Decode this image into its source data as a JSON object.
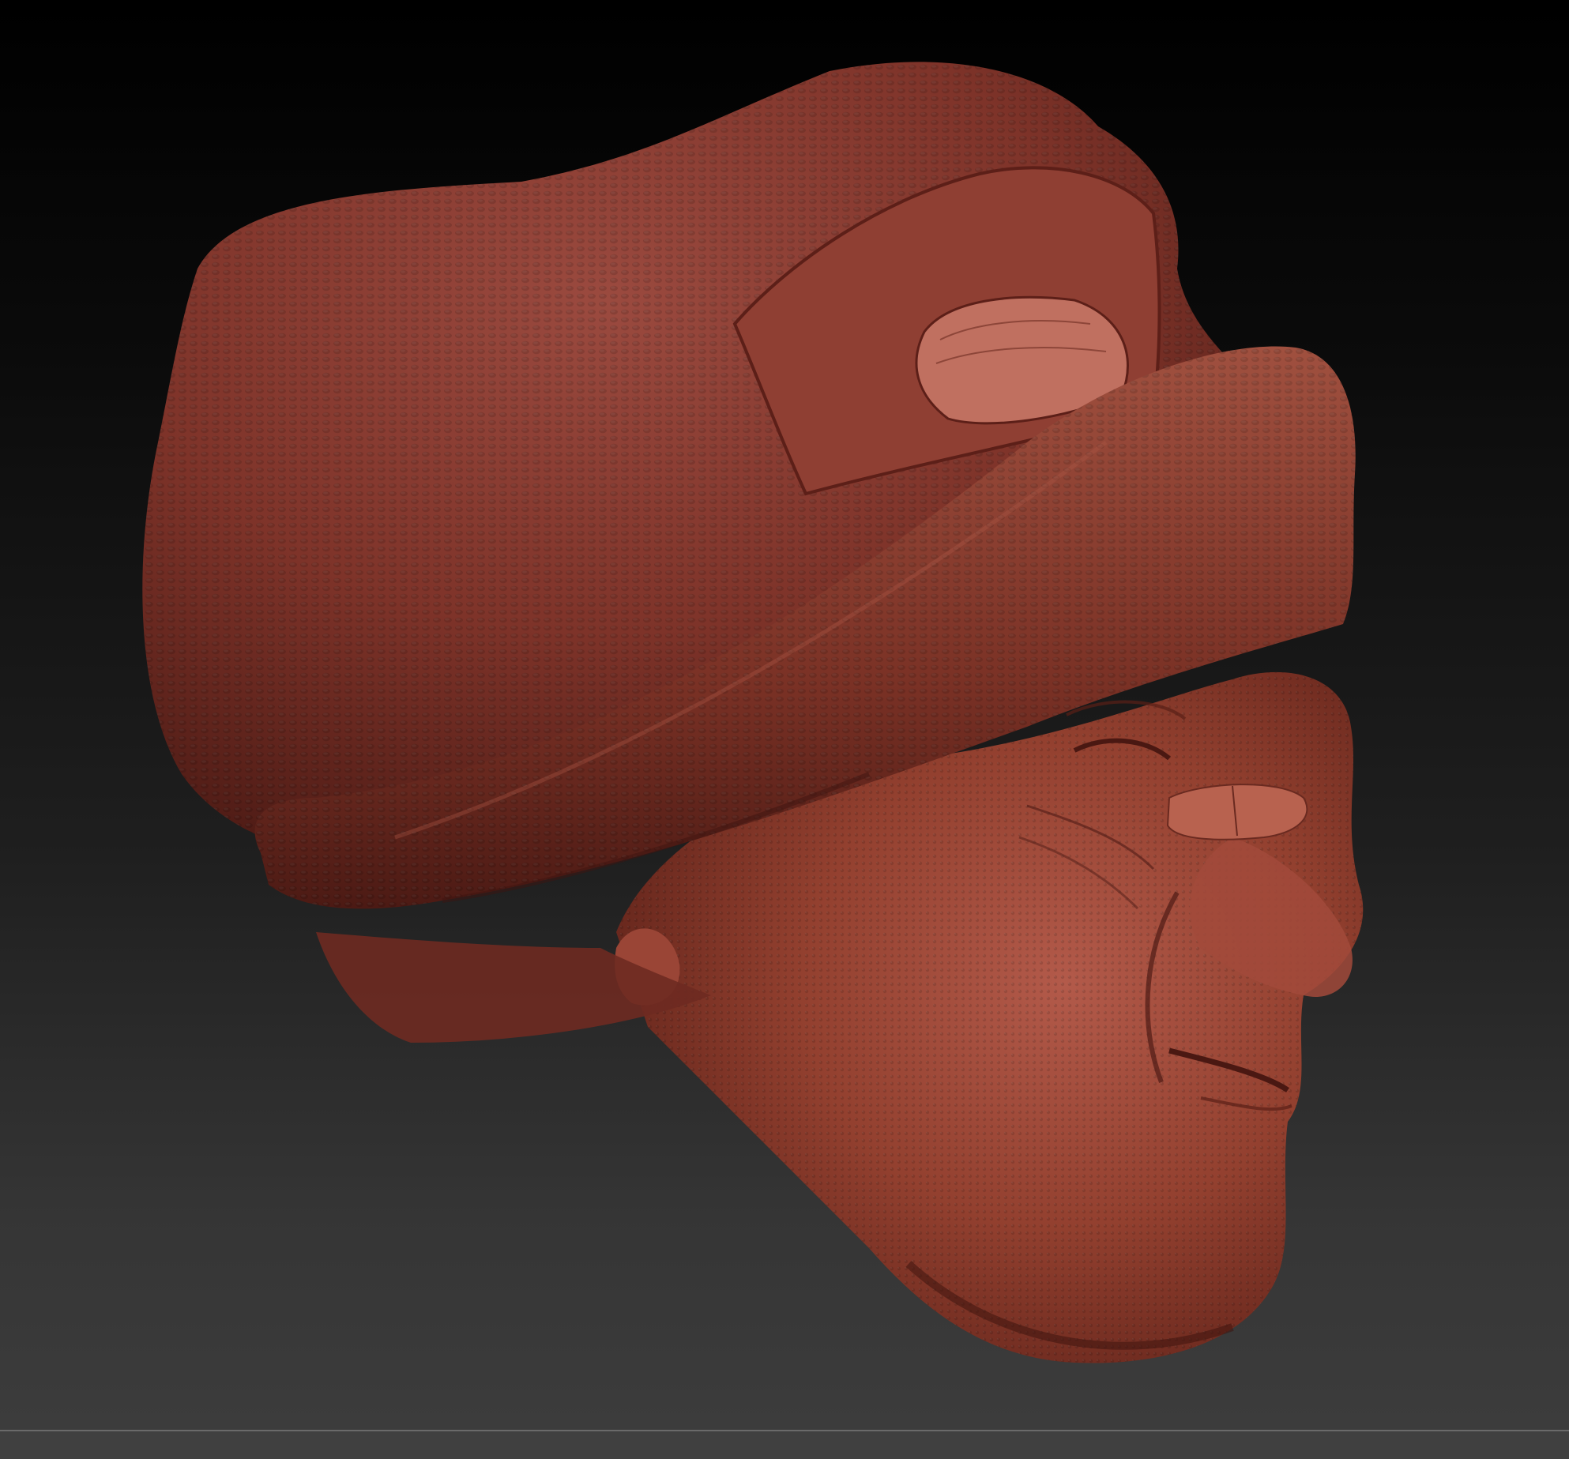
{
  "viewport": {
    "subject": "sculpted-head-with-wrapped-cloth",
    "material_color": "#8a3a30",
    "background_top": "#000000",
    "background_bottom": "#3c3c3c"
  }
}
